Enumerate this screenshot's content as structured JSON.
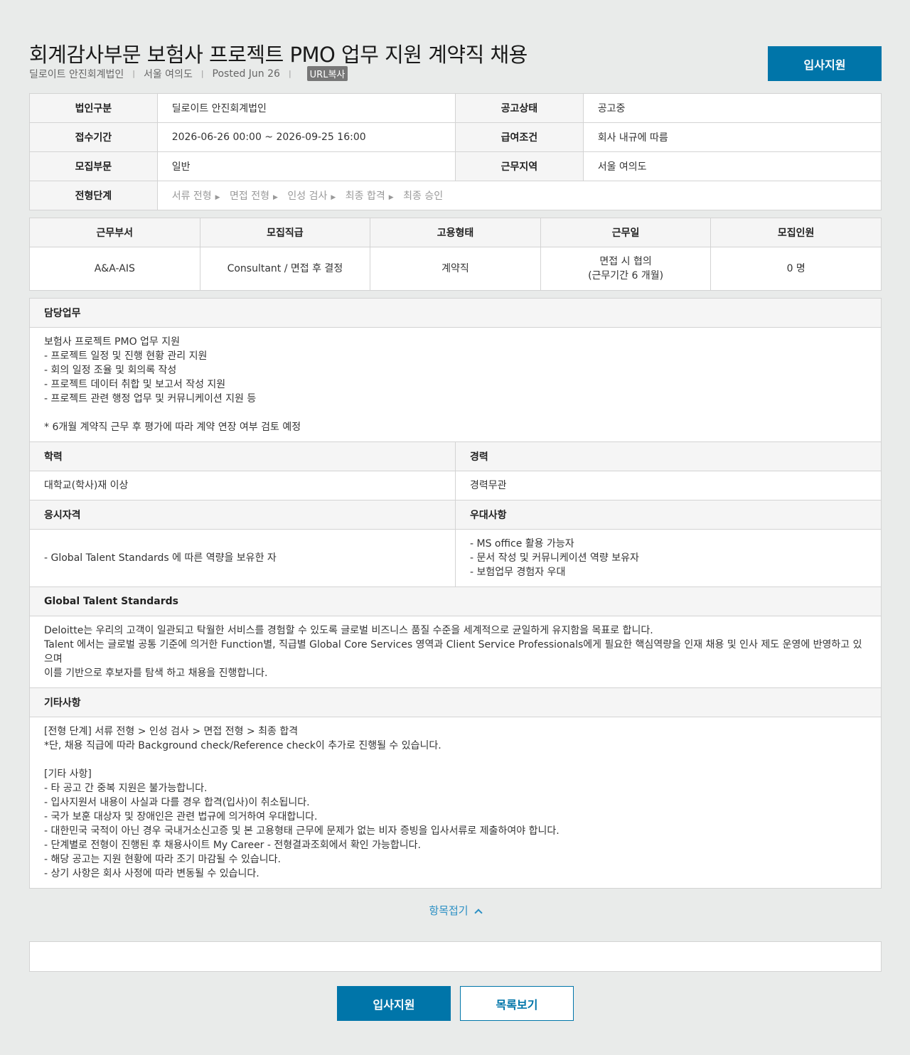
{
  "header": {
    "title": "회계감사부문 보험사 프로젝트 PMO 업무 지원 계약직 채용",
    "company": "딜로이트 안진회계법인",
    "location": "서울 여의도",
    "posted": "Posted Jun 26",
    "url_copy": "URL복사",
    "apply_label": "입사지원"
  },
  "info": {
    "corp_label": "법인구분",
    "corp_value": "딜로이트 안진회계법인",
    "status_label": "공고상태",
    "status_value": "공고중",
    "period_label": "접수기간",
    "period_value": "2026-06-26 00:00 ~ 2026-09-25 16:00",
    "salary_label": "급여조건",
    "salary_value": "회사 내규에 따름",
    "dept_label": "모집부문",
    "dept_value": "일반",
    "area_label": "근무지역",
    "area_value": "서울 여의도",
    "steps_label": "전형단계",
    "steps": [
      "서류 전형",
      "면접 전형",
      "인성 검사",
      "최종 합격",
      "최종 승인"
    ]
  },
  "recruit": {
    "headers": [
      "근무부서",
      "모집직급",
      "고용형태",
      "근무일",
      "모집인원"
    ],
    "row": {
      "dept": "A&A-AIS",
      "grade": "Consultant / 면접 후 결정",
      "type": "계약직",
      "workday_1": "면접 시 협의",
      "workday_2": "(근무기간 6 개월)",
      "count": "0 명"
    }
  },
  "details": {
    "duty_label": "담당업무",
    "duty_text": "보험사 프로젝트 PMO 업무 지원\n- 프로젝트 일정 및 진행 현황 관리 지원\n- 회의 일정 조율 및 회의록 작성\n- 프로젝트 데이터 취합 및 보고서 작성 지원\n- 프로젝트 관련 행정 업무 및 커뮤니케이션 지원 등\n\n* 6개월 계약직 근무 후 평가에 따라 계약 연장 여부 검토 예정",
    "edu_label": "학력",
    "edu_value": "대학교(학사)재 이상",
    "career_label": "경력",
    "career_value": "경력무관",
    "qual_label": "응시자격",
    "qual_value": "- Global Talent Standards 에 따른 역량을 보유한 자",
    "pref_label": "우대사항",
    "pref_value": "- MS office 활용 가능자\n- 문서 작성 및 커뮤니케이션 역량 보유자\n- 보험업무 경험자 우대",
    "gts_label": "Global Talent Standards",
    "gts_text": "Deloitte는 우리의 고객이 일관되고 탁월한 서비스를 경험할 수 있도록 글로벌 비즈니스 품질 수준을 세계적으로 균일하게 유지함을 목표로 합니다.\nTalent 에서는 글로벌 공통 기준에 의거한 Function별, 직급별 Global Core Services 영역과 Client Service Professionals에게 필요한 핵심역량을 인재 채용 및 인사 제도 운영에 반영하고 있으며\n이를 기반으로 후보자를 탐색 하고 채용을 진행합니다.",
    "etc_label": "기타사항",
    "etc_text": "[전형 단계] 서류 전형 > 인성 검사 > 면접 전형 > 최종 합격\n*단, 채용 직급에 따라 Background check/Reference check이 추가로 진행될 수 있습니다.\n\n[기타 사항]\n- 타 공고 간 중복 지원은 불가능합니다.\n- 입사지원서 내용이 사실과 다를 경우 합격(입사)이 취소됩니다.\n- 국가 보훈 대상자 및 장애인은 관련 법규에 의거하여 우대합니다.\n- 대한민국 국적이 아닌 경우 국내거소신고증 및 본 고용형태 근무에 문제가 없는 비자 증빙을 입사서류로 제출하여야 합니다.\n- 단계별로 전형이 진행된 후 채용사이트 My Career - 전형결과조회에서 확인 가능합니다.\n- 해당 공고는 지원 현황에 따라 조기 마감될 수 있습니다.\n- 상기 사항은 회사 사정에 따라 변동될 수 있습니다."
  },
  "footer": {
    "fold_label": "항목접기",
    "apply_label": "입사지원",
    "list_label": "목록보기"
  }
}
